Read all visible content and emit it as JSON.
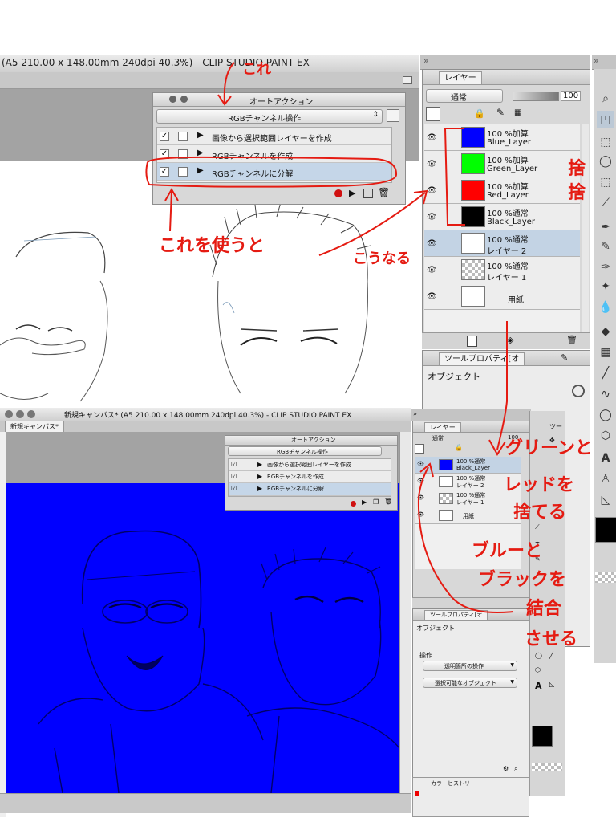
{
  "main_window": {
    "title": "(A5 210.00 x 148.00mm 240dpi 40.3%)  - CLIP STUDIO PAINT EX"
  },
  "auto_action_panel": {
    "title": "オートアクション",
    "set_name": "RGBチャンネル操作",
    "items": [
      {
        "label": "画像から選択範囲レイヤーを作成",
        "checked": true
      },
      {
        "label": "RGBチャンネルを作成",
        "checked": true
      },
      {
        "label": "RGBチャンネルに分解",
        "checked": true
      }
    ]
  },
  "layer_panel": {
    "tab_label": "レイヤー",
    "blend_mode": "通常",
    "opacity": "100",
    "layers": [
      {
        "line1": "100 %加算",
        "line2": "Blue_Layer",
        "color": "#0000ff"
      },
      {
        "line1": "100 %加算",
        "line2": "Green_Layer",
        "color": "#00ff00"
      },
      {
        "line1": "100 %加算",
        "line2": "Red_Layer",
        "color": "#ff0000"
      },
      {
        "line1": "100 %通常",
        "line2": "Black_Layer",
        "color": "#000000"
      },
      {
        "line1": "100 %通常",
        "line2": "レイヤー 2",
        "color": "#ffffff"
      },
      {
        "line1": "100 %通常",
        "line2": "レイヤー 1",
        "color": "checker"
      },
      {
        "line1": "",
        "line2": "用紙",
        "color": "#ffffff"
      }
    ]
  },
  "tool_property_panel": {
    "tab_label": "ツールプロパティ[オ",
    "object_label": "オブジェクト"
  },
  "second_window": {
    "title": "新規キャンバス* (A5 210.00 x 148.00mm 240dpi 40.3%)  - CLIP STUDIO PAINT EX",
    "doc_tab": "新規キャンバス*",
    "canvas_color": "#0000ff",
    "auto_action": {
      "title": "オートアクション",
      "set_name": "RGBチャンネル操作",
      "items": [
        {
          "label": "画像から選択範囲レイヤーを作成"
        },
        {
          "label": "RGBチャンネルを作成"
        },
        {
          "label": "RGBチャンネルに分解"
        }
      ]
    },
    "layer_panel": {
      "tab_label": "レイヤー",
      "blend_mode": "通常",
      "opacity": "100",
      "layers": [
        {
          "line1": "100 %通常",
          "line2": "Black_Layer",
          "color": "#0000ff"
        },
        {
          "line1": "100 %通常",
          "line2": "レイヤー 2",
          "color": "#ffffff"
        },
        {
          "line1": "100 %通常",
          "line2": "レイヤー 1",
          "color": "checker"
        },
        {
          "line1": "",
          "line2": "用紙",
          "color": "#ffffff"
        }
      ]
    },
    "tool_property": {
      "tab_label": "ツールプロパティ[オ",
      "object_label": "オブジェクト",
      "operation_label": "操作",
      "dropdown1": "透明箇所の操作",
      "dropdown2": "選択可能なオブジェクト"
    },
    "color_history_label": "カラーヒストリー",
    "tool_tab": "ツー"
  },
  "annotations": {
    "kore": "これ",
    "korewo_tsukau_to": "これを使うと",
    "kounaru": "こうなる",
    "sute1": "捨",
    "sute2": "捨",
    "green_red": "グリーンと",
    "red_wo": "レッドを",
    "suteru": "捨てる",
    "blue_to": "ブルーと",
    "black_wo": "ブラックを",
    "ketsugo": "結合",
    "saseru": "させる"
  },
  "colors": {
    "annotation_red": "#e51b12",
    "selection_blue": "#c3d3e4",
    "canvas_blue": "#0000ff"
  }
}
